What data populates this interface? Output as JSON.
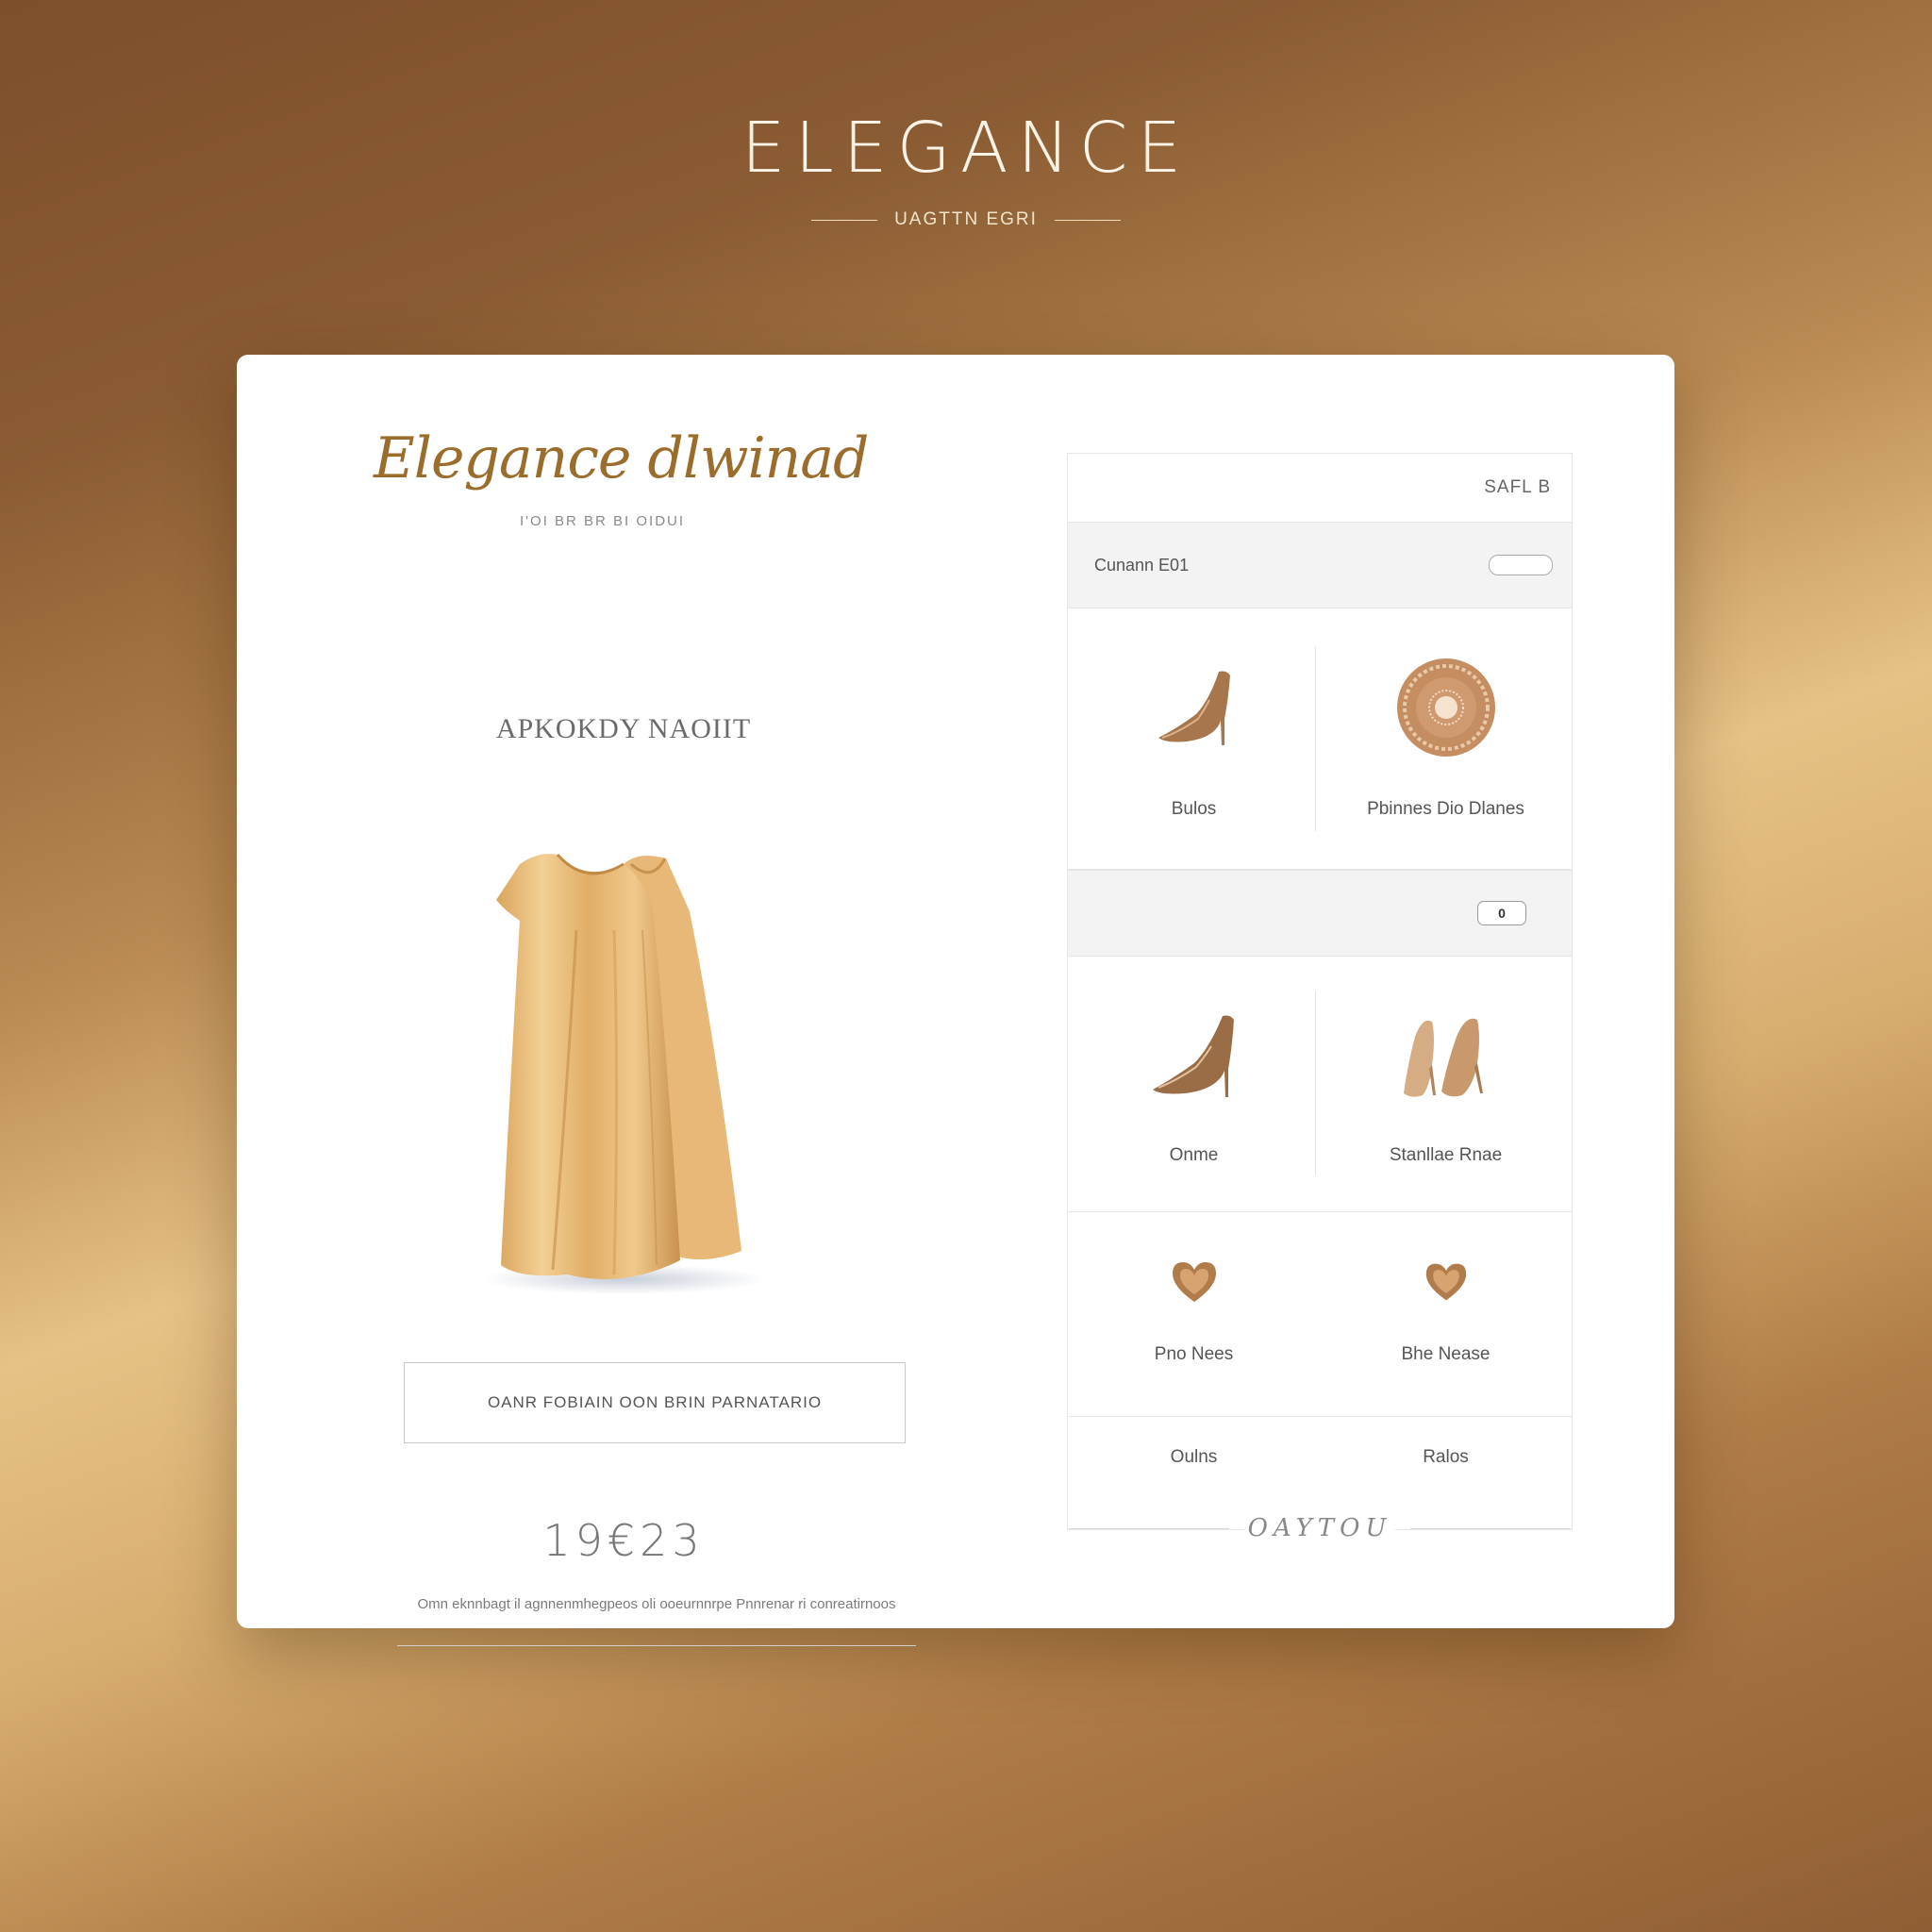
{
  "header": {
    "brand": "ELEGANCE",
    "tagline": "UAGTTN EGRI"
  },
  "left": {
    "script_title": "Elegance dlwinad",
    "script_subtitle": "I'OI BR BR BI OIDUI",
    "product_name": "APKOKDY NAOIIT",
    "cta_label": "OANR FOBIAIN OON BRIN PARNATARIO",
    "price": "19€23",
    "description": "Omn eknnbagt il agnnenmhegpeos oli ooeurnnrpe Pnnrenar ri conreatirnoos"
  },
  "panel": {
    "header_label": "SAFL B",
    "bar1_label": "Cunann E01",
    "bar2_badge": "0",
    "items_row1": [
      {
        "label": "Bulos",
        "icon": "high-heel-icon"
      },
      {
        "label": "Pbinnes Dio Dlanes",
        "icon": "round-plate-icon"
      }
    ],
    "items_row2": [
      {
        "label": "Onme",
        "icon": "high-heel-icon"
      },
      {
        "label": "Stanllae Rnae",
        "icon": "heels-pair-icon"
      }
    ],
    "items_row3": [
      {
        "label": "Pno Nees",
        "icon": "heart-icon"
      },
      {
        "label": "Bhe Nease",
        "icon": "heart-icon"
      }
    ],
    "links_row": [
      "Oulns",
      "Ralos"
    ],
    "footer_label": "OAYTOU"
  },
  "colors": {
    "accent_gold": "#9a6d2d",
    "product_gold": "#e2b36f",
    "card_bg": "#ffffff"
  }
}
